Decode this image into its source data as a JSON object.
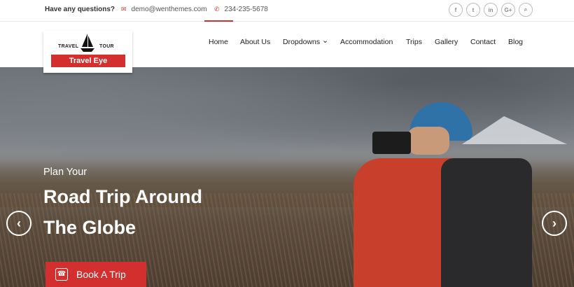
{
  "topbar": {
    "question": "Have any questions?",
    "email": "demo@wenthemes.com",
    "phone": "234-235-5678",
    "social": [
      {
        "icon": "facebook-icon",
        "glyph": "f"
      },
      {
        "icon": "twitter-icon",
        "glyph": "t"
      },
      {
        "icon": "linkedin-icon",
        "glyph": "in"
      },
      {
        "icon": "google-plus-icon",
        "glyph": "G+"
      },
      {
        "icon": "search-icon",
        "glyph": "⌕"
      }
    ]
  },
  "logo": {
    "travel": "TRAVEL",
    "tour": "TOUR",
    "name": "Travel Eye"
  },
  "nav": {
    "items": [
      {
        "label": "Home"
      },
      {
        "label": "About Us"
      },
      {
        "label": "Dropdowns"
      },
      {
        "label": "Accommodation"
      },
      {
        "label": "Trips"
      },
      {
        "label": "Gallery"
      },
      {
        "label": "Contact"
      },
      {
        "label": "Blog"
      }
    ],
    "dropdown_chevron": "⌄"
  },
  "hero": {
    "kicker": "Plan Your",
    "title_line1": "Road Trip Around",
    "title_line2": "The Globe",
    "cta": "Book A Trip"
  },
  "colors": {
    "accent": "#d32f2f"
  }
}
